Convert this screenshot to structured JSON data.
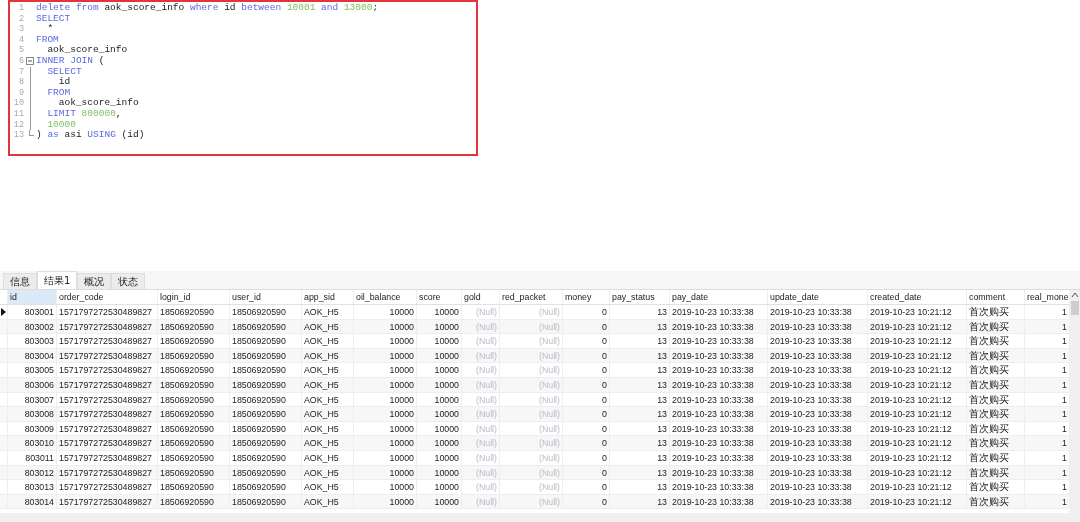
{
  "editor": {
    "lines": [
      {
        "no": "1",
        "tokens": [
          {
            "text": "delete from",
            "kind": "keyword"
          },
          {
            "text": " aok_score_info ",
            "kind": "plain"
          },
          {
            "text": "where",
            "kind": "keyword"
          },
          {
            "text": " id ",
            "kind": "plain"
          },
          {
            "text": "between",
            "kind": "keyword"
          },
          {
            "text": " 10001 ",
            "kind": "number"
          },
          {
            "text": "and",
            "kind": "keyword"
          },
          {
            "text": " 13000",
            "kind": "number"
          },
          {
            "text": ";",
            "kind": "plain"
          }
        ]
      },
      {
        "no": "2",
        "tokens": [
          {
            "text": "SELECT",
            "kind": "keyword"
          }
        ]
      },
      {
        "no": "3",
        "tokens": [
          {
            "text": "  *",
            "kind": "plain"
          }
        ]
      },
      {
        "no": "4",
        "tokens": [
          {
            "text": "FROM",
            "kind": "keyword"
          }
        ]
      },
      {
        "no": "5",
        "tokens": [
          {
            "text": "  aok_score_info",
            "kind": "plain"
          }
        ]
      },
      {
        "no": "6",
        "kind": "fold_start",
        "tokens": [
          {
            "text": "INNER JOIN",
            "kind": "keyword"
          },
          {
            "text": " (",
            "kind": "plain"
          }
        ]
      },
      {
        "no": "7",
        "kind": "fold_inner",
        "tokens": [
          {
            "text": "  SELECT",
            "kind": "keyword"
          }
        ]
      },
      {
        "no": "8",
        "kind": "fold_inner",
        "tokens": [
          {
            "text": "    id",
            "kind": "plain"
          }
        ]
      },
      {
        "no": "9",
        "kind": "fold_inner",
        "tokens": [
          {
            "text": "  FROM",
            "kind": "keyword"
          }
        ]
      },
      {
        "no": "10",
        "kind": "fold_inner",
        "tokens": [
          {
            "text": "    aok_score_info",
            "kind": "plain"
          }
        ]
      },
      {
        "no": "11",
        "kind": "fold_inner",
        "tokens": [
          {
            "text": "  LIMIT",
            "kind": "keyword"
          },
          {
            "text": " 800000",
            "kind": "number"
          },
          {
            "text": ",",
            "kind": "plain"
          }
        ]
      },
      {
        "no": "12",
        "kind": "fold_inner",
        "tokens": [
          {
            "text": "  10000",
            "kind": "number"
          }
        ]
      },
      {
        "no": "13",
        "kind": "fold_end",
        "tokens": [
          {
            "text": ") ",
            "kind": "plain"
          },
          {
            "text": "as",
            "kind": "keyword"
          },
          {
            "text": " asi ",
            "kind": "plain"
          },
          {
            "text": "USING",
            "kind": "keyword"
          },
          {
            "text": " (id)",
            "kind": "plain"
          }
        ]
      }
    ]
  },
  "tabs": [
    {
      "label": "信息",
      "selected": false
    },
    {
      "label": "结果1",
      "selected": true
    },
    {
      "label": "概况",
      "selected": false
    },
    {
      "label": "状态",
      "selected": false
    }
  ],
  "table": {
    "columns": [
      {
        "label": "id",
        "kind": "number"
      },
      {
        "label": "order_code",
        "kind": "text"
      },
      {
        "label": "login_id",
        "kind": "text"
      },
      {
        "label": "user_id",
        "kind": "text"
      },
      {
        "label": "app_sid",
        "kind": "text"
      },
      {
        "label": "oil_balance",
        "kind": "number"
      },
      {
        "label": "score",
        "kind": "number"
      },
      {
        "label": "gold",
        "kind": "null"
      },
      {
        "label": "red_packet",
        "kind": "null"
      },
      {
        "label": "money",
        "kind": "number"
      },
      {
        "label": "pay_status",
        "kind": "number"
      },
      {
        "label": "pay_date",
        "kind": "text"
      },
      {
        "label": "update_date",
        "kind": "text"
      },
      {
        "label": "created_date",
        "kind": "text"
      },
      {
        "label": "comment",
        "kind": "text"
      },
      {
        "label": "real_mone",
        "kind": "number"
      }
    ],
    "rows": [
      {
        "selected": true,
        "cells": [
          "803001",
          "1571797272530489827",
          "18506920590",
          "18506920590",
          "AOK_H5",
          "10000",
          "10000",
          "(Null)",
          "(Null)",
          "0",
          "13",
          "2019-10-23 10:33:38",
          "2019-10-23 10:33:38",
          "2019-10-23 10:21:12",
          "首次购买",
          "1"
        ]
      },
      {
        "selected": false,
        "cells": [
          "803002",
          "1571797272530489827",
          "18506920590",
          "18506920590",
          "AOK_H5",
          "10000",
          "10000",
          "(Null)",
          "(Null)",
          "0",
          "13",
          "2019-10-23 10:33:38",
          "2019-10-23 10:33:38",
          "2019-10-23 10:21:12",
          "首次购买",
          "1"
        ]
      },
      {
        "selected": false,
        "cells": [
          "803003",
          "1571797272530489827",
          "18506920590",
          "18506920590",
          "AOK_H5",
          "10000",
          "10000",
          "(Null)",
          "(Null)",
          "0",
          "13",
          "2019-10-23 10:33:38",
          "2019-10-23 10:33:38",
          "2019-10-23 10:21:12",
          "首次购买",
          "1"
        ]
      },
      {
        "selected": false,
        "cells": [
          "803004",
          "1571797272530489827",
          "18506920590",
          "18506920590",
          "AOK_H5",
          "10000",
          "10000",
          "(Null)",
          "(Null)",
          "0",
          "13",
          "2019-10-23 10:33:38",
          "2019-10-23 10:33:38",
          "2019-10-23 10:21:12",
          "首次购买",
          "1"
        ]
      },
      {
        "selected": false,
        "cells": [
          "803005",
          "1571797272530489827",
          "18506920590",
          "18506920590",
          "AOK_H5",
          "10000",
          "10000",
          "(Null)",
          "(Null)",
          "0",
          "13",
          "2019-10-23 10:33:38",
          "2019-10-23 10:33:38",
          "2019-10-23 10:21:12",
          "首次购买",
          "1"
        ]
      },
      {
        "selected": false,
        "cells": [
          "803006",
          "1571797272530489827",
          "18506920590",
          "18506920590",
          "AOK_H5",
          "10000",
          "10000",
          "(Null)",
          "(Null)",
          "0",
          "13",
          "2019-10-23 10:33:38",
          "2019-10-23 10:33:38",
          "2019-10-23 10:21:12",
          "首次购买",
          "1"
        ]
      },
      {
        "selected": false,
        "cells": [
          "803007",
          "1571797272530489827",
          "18506920590",
          "18506920590",
          "AOK_H5",
          "10000",
          "10000",
          "(Null)",
          "(Null)",
          "0",
          "13",
          "2019-10-23 10:33:38",
          "2019-10-23 10:33:38",
          "2019-10-23 10:21:12",
          "首次购买",
          "1"
        ]
      },
      {
        "selected": false,
        "cells": [
          "803008",
          "1571797272530489827",
          "18506920590",
          "18506920590",
          "AOK_H5",
          "10000",
          "10000",
          "(Null)",
          "(Null)",
          "0",
          "13",
          "2019-10-23 10:33:38",
          "2019-10-23 10:33:38",
          "2019-10-23 10:21:12",
          "首次购买",
          "1"
        ]
      },
      {
        "selected": false,
        "cells": [
          "803009",
          "1571797272530489827",
          "18506920590",
          "18506920590",
          "AOK_H5",
          "10000",
          "10000",
          "(Null)",
          "(Null)",
          "0",
          "13",
          "2019-10-23 10:33:38",
          "2019-10-23 10:33:38",
          "2019-10-23 10:21:12",
          "首次购买",
          "1"
        ]
      },
      {
        "selected": false,
        "cells": [
          "803010",
          "1571797272530489827",
          "18506920590",
          "18506920590",
          "AOK_H5",
          "10000",
          "10000",
          "(Null)",
          "(Null)",
          "0",
          "13",
          "2019-10-23 10:33:38",
          "2019-10-23 10:33:38",
          "2019-10-23 10:21:12",
          "首次购买",
          "1"
        ]
      },
      {
        "selected": false,
        "cells": [
          "803011",
          "1571797272530489827",
          "18506920590",
          "18506920590",
          "AOK_H5",
          "10000",
          "10000",
          "(Null)",
          "(Null)",
          "0",
          "13",
          "2019-10-23 10:33:38",
          "2019-10-23 10:33:38",
          "2019-10-23 10:21:12",
          "首次购买",
          "1"
        ]
      },
      {
        "selected": false,
        "cells": [
          "803012",
          "1571797272530489827",
          "18506920590",
          "18506920590",
          "AOK_H5",
          "10000",
          "10000",
          "(Null)",
          "(Null)",
          "0",
          "13",
          "2019-10-23 10:33:38",
          "2019-10-23 10:33:38",
          "2019-10-23 10:21:12",
          "首次购买",
          "1"
        ]
      },
      {
        "selected": false,
        "cells": [
          "803013",
          "1571797272530489827",
          "18506920590",
          "18506920590",
          "AOK_H5",
          "10000",
          "10000",
          "(Null)",
          "(Null)",
          "0",
          "13",
          "2019-10-23 10:33:38",
          "2019-10-23 10:33:38",
          "2019-10-23 10:21:12",
          "首次购买",
          "1"
        ]
      },
      {
        "selected": false,
        "cells": [
          "803014",
          "1571797272530489827",
          "18506920590",
          "18506920590",
          "AOK_H5",
          "10000",
          "10000",
          "(Null)",
          "(Null)",
          "0",
          "13",
          "2019-10-23 10:33:38",
          "2019-10-23 10:33:38",
          "2019-10-23 10:21:12",
          "首次购买",
          "1"
        ]
      }
    ]
  }
}
